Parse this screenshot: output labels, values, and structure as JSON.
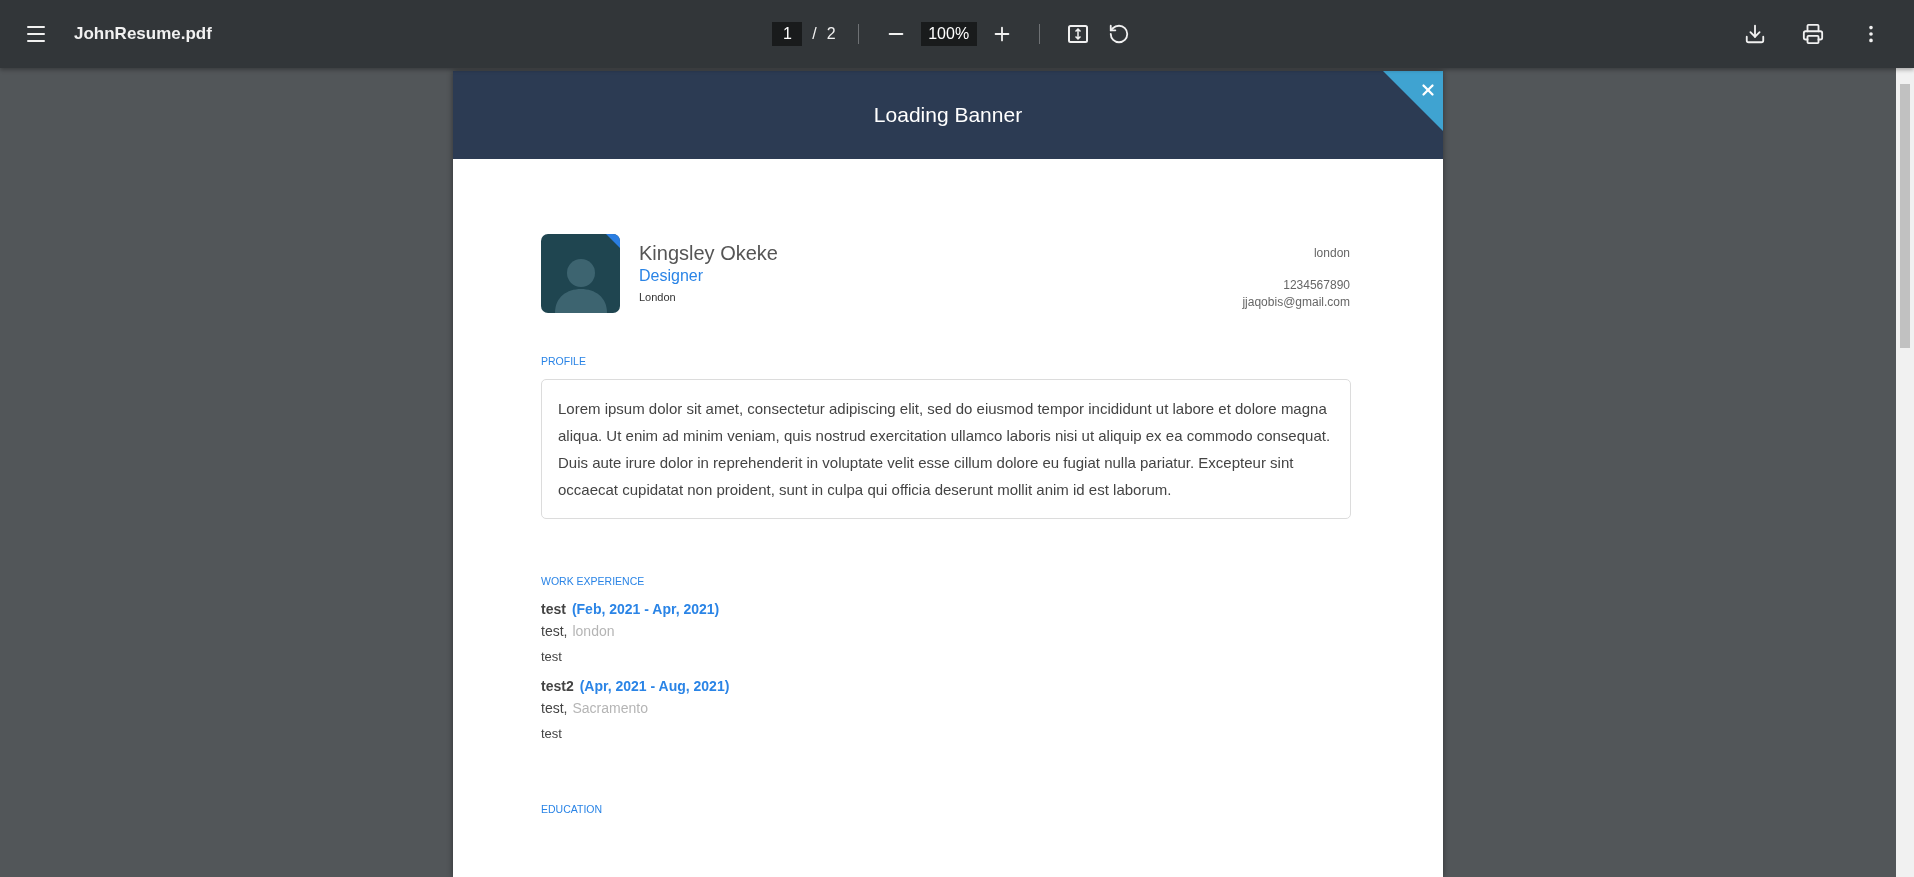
{
  "toolbar": {
    "file_name": "JohnResume.pdf",
    "page_current": "1",
    "page_separator": "/",
    "page_total": "2",
    "zoom": "100%"
  },
  "banner": {
    "title": "Loading Banner"
  },
  "resume": {
    "name": "Kingsley Okeke",
    "role": "Designer",
    "city": "London",
    "contact": [
      {
        "kind": "address",
        "text": "london"
      },
      {
        "kind": "phone",
        "text": "1234567890"
      },
      {
        "kind": "email",
        "text": "jjaqobis@gmail.com"
      }
    ],
    "profile": {
      "heading": "PROFILE",
      "text": "Lorem ipsum dolor sit amet, consectetur adipiscing elit, sed do eiusmod tempor incididunt ut labore et dolore magna aliqua. Ut enim ad minim veniam, quis nostrud exercitation ullamco laboris nisi ut aliquip ex ea commodo consequat. Duis aute irure dolor in reprehenderit in voluptate velit esse cillum dolore eu fugiat nulla pariatur. Excepteur sint occaecat cupidatat non proident, sunt in culpa qui officia deserunt mollit anim id est laborum."
    },
    "work": {
      "heading": "WORK EXPERIENCE",
      "jobs": [
        {
          "title": "test",
          "dates": "(Feb, 2021 - Apr, 2021)",
          "company": "test,",
          "location": "london",
          "description": "test"
        },
        {
          "title": "test2",
          "dates": "(Apr, 2021 - Aug, 2021)",
          "company": "test,",
          "location": "Sacramento",
          "description": "test"
        }
      ]
    },
    "education": {
      "heading": "EDUCATION"
    }
  }
}
